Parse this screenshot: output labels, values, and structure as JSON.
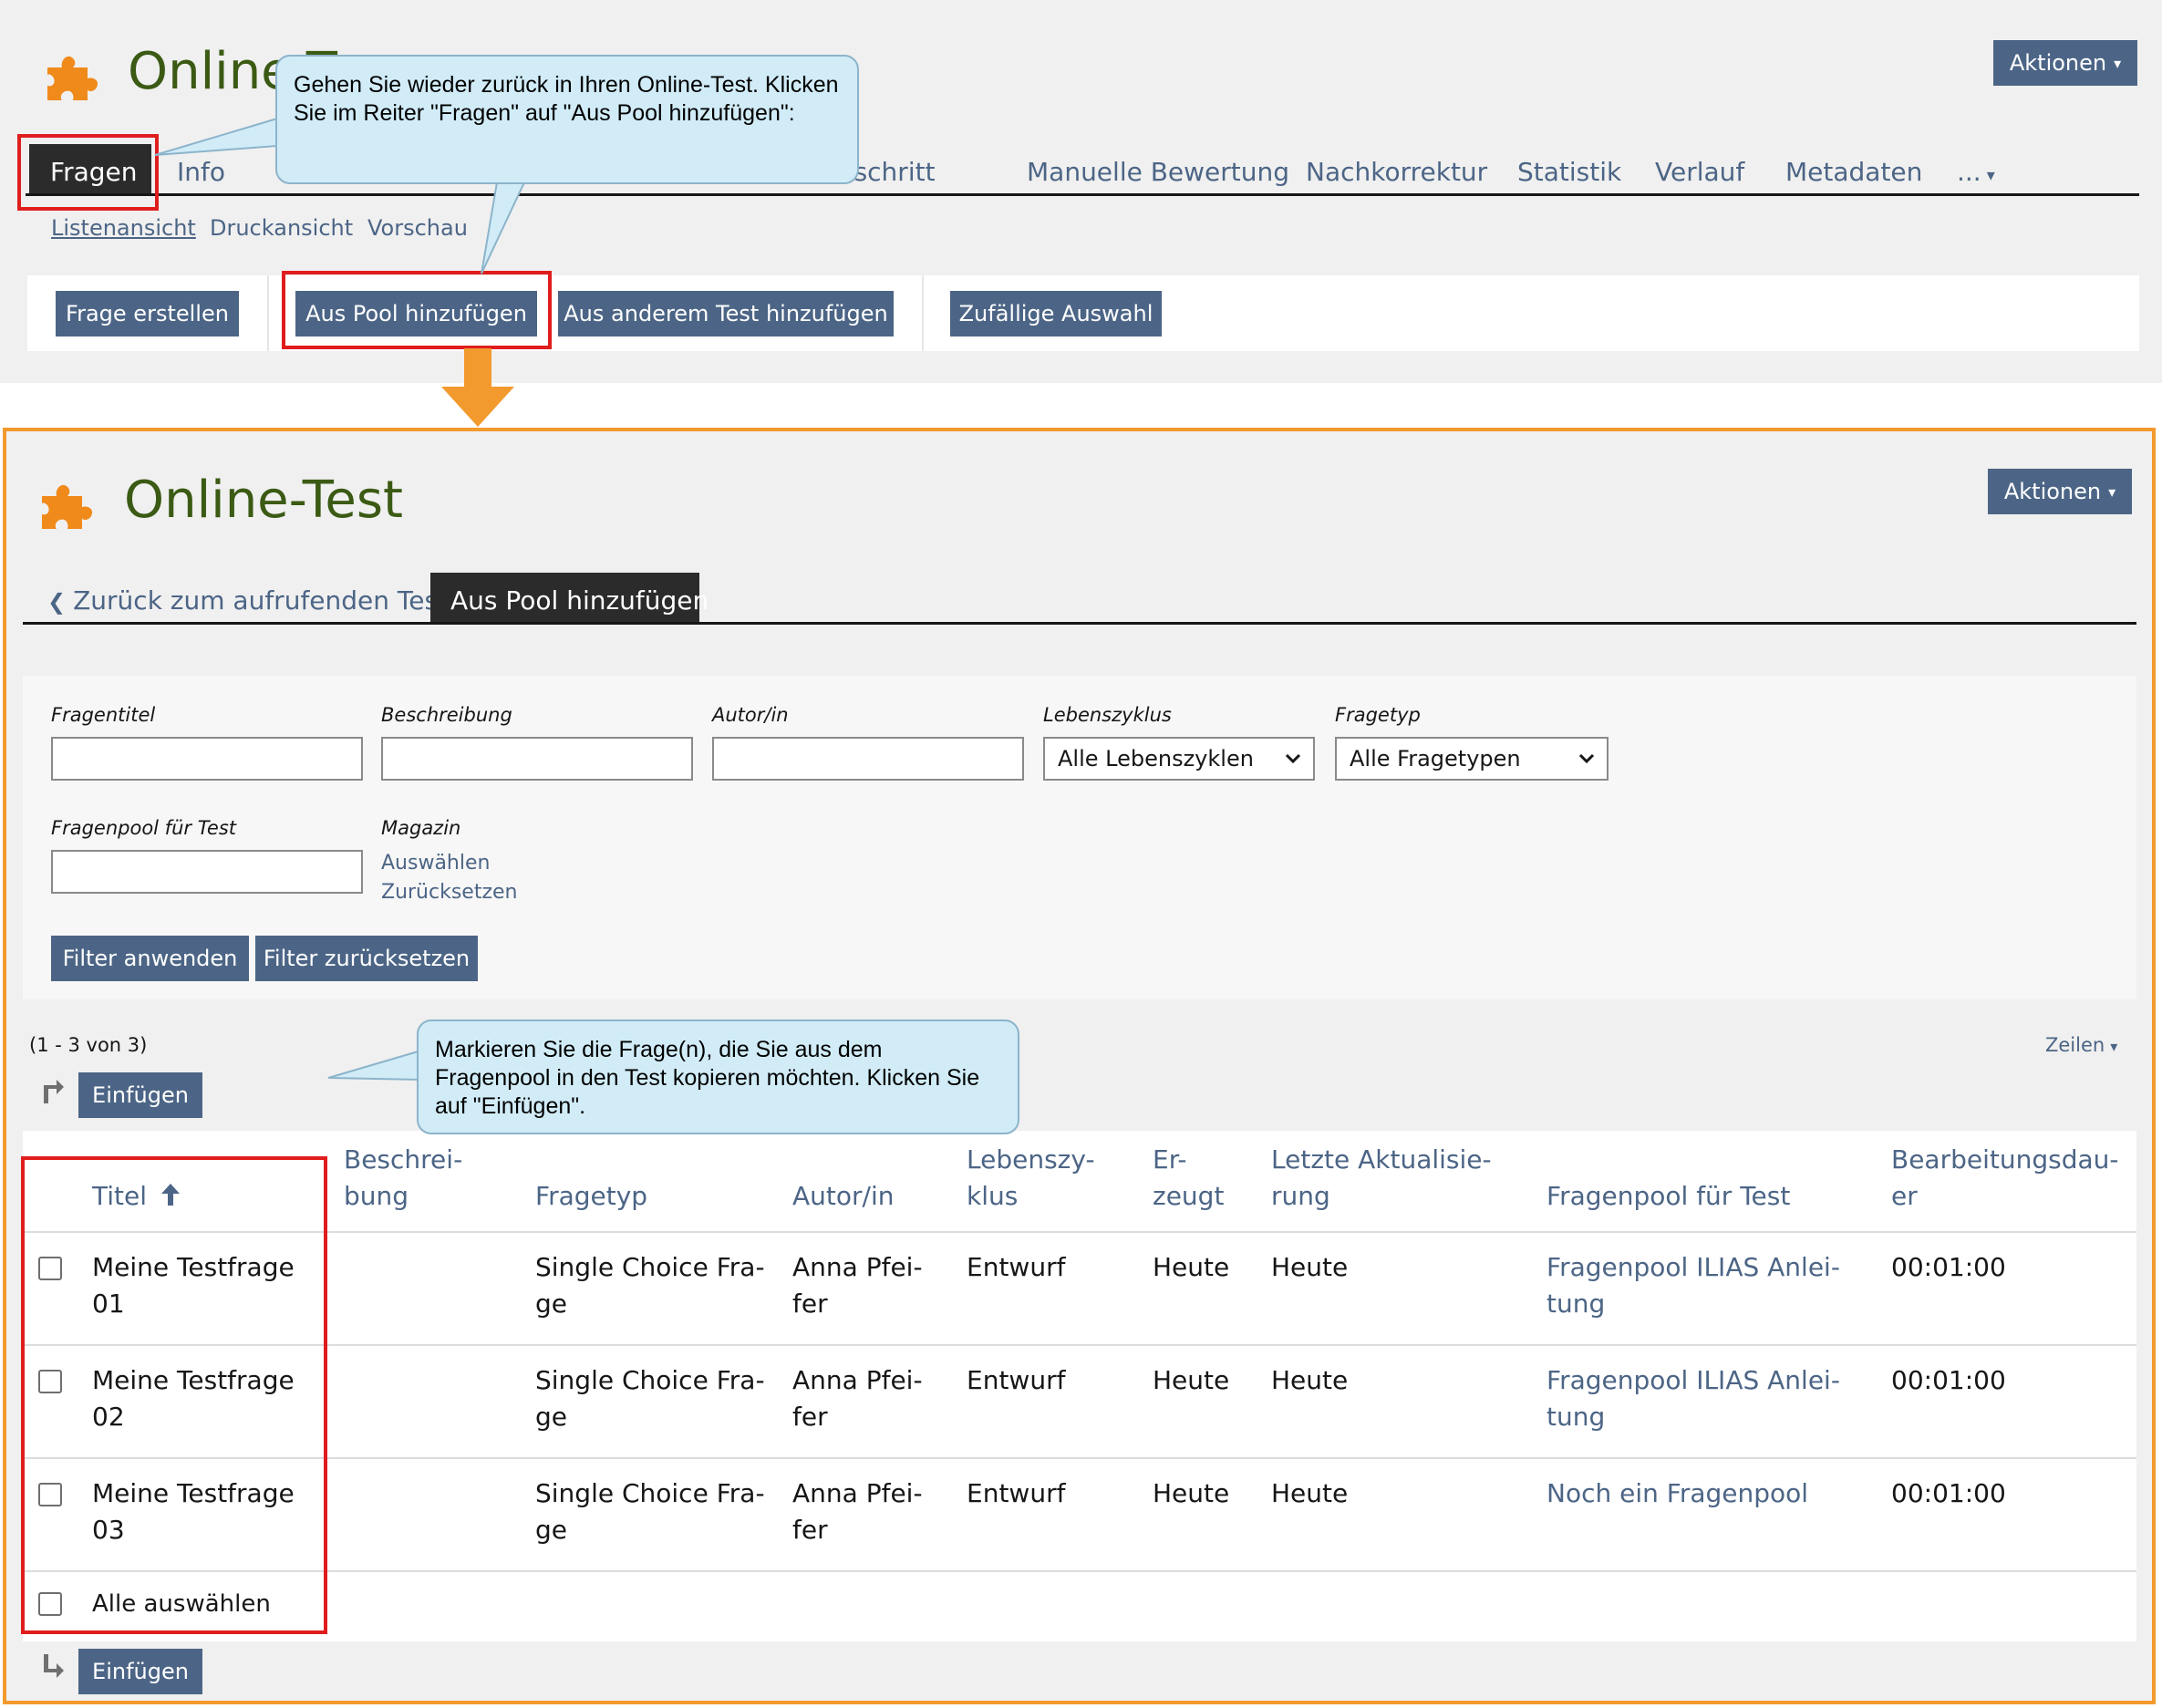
{
  "top": {
    "title": "Online-T",
    "actions_label": "Aktionen",
    "tabs": [
      "Fragen",
      "Info",
      "Lernfortschritt",
      "Manuelle Bewertung",
      "Nachkorrektur",
      "Statistik",
      "Verlauf",
      "Metadaten",
      "..."
    ],
    "subtabs": [
      "Listenansicht",
      "Druckansicht",
      "Vorschau"
    ],
    "toolbar_buttons": [
      "Frage erstellen",
      "Aus Pool hinzufügen",
      "Aus anderem Test hinzufügen",
      "Zufällige Auswahl"
    ],
    "callout": "Gehen Sie wieder zurück in Ihren Online-Test. Klicken Sie im Reiter \"Fragen\" auf \"Aus Pool hinzufügen\":"
  },
  "bottom": {
    "title": "Online-Test",
    "actions_label": "Aktionen",
    "back_link": "Zurück zum aufrufenden Test",
    "active_tab": "Aus Pool hinzufügen",
    "filter": {
      "labels": {
        "fragentitel": "Fragentitel",
        "beschreibung": "Beschreibung",
        "autor": "Autor/in",
        "lebenszyklus": "Lebenszyklus",
        "fragetyp": "Fragetyp",
        "fragenpool": "Fragenpool für Test",
        "magazin": "Magazin"
      },
      "lebenszyklus_value": "Alle Lebenszyklen",
      "fragetyp_value": "Alle Fragetypen",
      "magazin_select": "Auswählen",
      "magazin_reset": "Zurücksetzen",
      "apply_button": "Filter anwenden",
      "reset_button": "Filter zurücksetzen"
    },
    "count_text": "(1 - 3 von 3)",
    "rows_menu": "Zeilen",
    "insert_button": "Einfügen",
    "callout": "Markieren Sie die Frage(n), die Sie aus dem Fragenpool in den Test kopieren möchten. Klicken Sie auf \"Einfügen\".",
    "table": {
      "headers": {
        "titel": "Titel",
        "beschreibung_1": "Beschrei-",
        "beschreibung_2": "bung",
        "fragetyp": "Fragetyp",
        "autor": "Autor/in",
        "lebenszyklus_1": "Lebenszy-",
        "lebenszyklus_2": "klus",
        "erzeugt_1": "Er-",
        "erzeugt_2": "zeugt",
        "aktualisierung_1": "Letzte Aktualisie-",
        "aktualisierung_2": "rung",
        "fragenpool": "Fragenpool für Test",
        "dauer_1": "Bearbeitungsdau-",
        "dauer_2": "er"
      },
      "rows": [
        {
          "titel_1": "Meine Testfrage",
          "titel_2": "01",
          "typ_1": "Single Choice Fra-",
          "typ_2": "ge",
          "autor_1": "Anna Pfei-",
          "autor_2": "fer",
          "status": "Entwurf",
          "erzeugt": "Heute",
          "aktualisiert": "Heute",
          "pool_1": "Fragenpool ILIAS Anlei-",
          "pool_2": "tung",
          "dauer": "00:01:00"
        },
        {
          "titel_1": "Meine Testfrage",
          "titel_2": "02",
          "typ_1": "Single Choice Fra-",
          "typ_2": "ge",
          "autor_1": "Anna Pfei-",
          "autor_2": "fer",
          "status": "Entwurf",
          "erzeugt": "Heute",
          "aktualisiert": "Heute",
          "pool_1": "Fragenpool ILIAS Anlei-",
          "pool_2": "tung",
          "dauer": "00:01:00"
        },
        {
          "titel_1": "Meine Testfrage",
          "titel_2": "03",
          "typ_1": "Single Choice Fra-",
          "typ_2": "ge",
          "autor_1": "Anna Pfei-",
          "autor_2": "fer",
          "status": "Entwurf",
          "erzeugt": "Heute",
          "aktualisiert": "Heute",
          "pool_1": "Noch ein Fragenpool",
          "pool_2": "",
          "dauer": "00:01:00"
        }
      ],
      "select_all": "Alle auswählen"
    }
  },
  "colors": {
    "primary_button": "#4c6586",
    "title_green": "#3b5a14",
    "highlight_red": "#e01d1d",
    "frame_orange": "#f39a2e",
    "callout_fill": "#d1ecf7",
    "puzzle_orange": "#f08a1a"
  },
  "icons": [
    "puzzle-icon",
    "caret-down-icon",
    "arrow-down-icon",
    "chevron-left-icon",
    "sort-up-icon",
    "arrow-turn-up-icon",
    "arrow-turn-down-icon"
  ]
}
